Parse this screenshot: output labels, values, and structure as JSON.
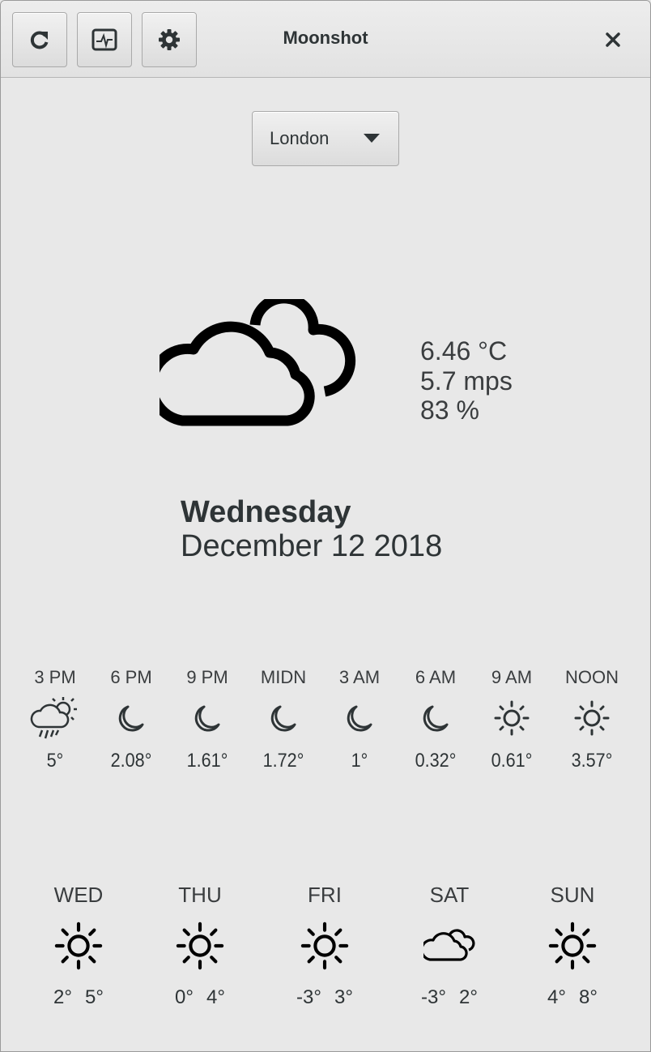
{
  "app": {
    "title": "Moonshot"
  },
  "header": {
    "buttons": [
      {
        "icon": "refresh-icon"
      },
      {
        "icon": "system-monitor-icon"
      },
      {
        "icon": "gear-icon"
      }
    ],
    "close_icon": "close-icon"
  },
  "location": {
    "selected": "London"
  },
  "current": {
    "icon": "cloudy-icon",
    "temperature": "6.46 °C",
    "wind": "5.7 mps",
    "humidity": "83 %",
    "day": "Wednesday",
    "date": "December 12 2018"
  },
  "hourly": [
    {
      "label": "3 PM",
      "icon": "rain-sun-icon",
      "temp": "5°"
    },
    {
      "label": "6 PM",
      "icon": "moon-icon",
      "temp": "2.08°"
    },
    {
      "label": "9 PM",
      "icon": "moon-icon",
      "temp": "1.61°"
    },
    {
      "label": "MIDN",
      "icon": "moon-icon",
      "temp": "1.72°"
    },
    {
      "label": "3 AM",
      "icon": "moon-icon",
      "temp": "1°"
    },
    {
      "label": "6 AM",
      "icon": "moon-icon",
      "temp": "0.32°"
    },
    {
      "label": "9 AM",
      "icon": "sun-icon",
      "temp": "0.61°"
    },
    {
      "label": "NOON",
      "icon": "sun-icon",
      "temp": "3.57°"
    }
  ],
  "daily": [
    {
      "label": "WED",
      "icon": "sun-icon",
      "low": "2°",
      "high": "5°"
    },
    {
      "label": "THU",
      "icon": "sun-icon",
      "low": "0°",
      "high": "4°"
    },
    {
      "label": "FRI",
      "icon": "sun-icon",
      "low": "-3°",
      "high": "3°"
    },
    {
      "label": "SAT",
      "icon": "cloud-icon",
      "low": "-3°",
      "high": "2°"
    },
    {
      "label": "SUN",
      "icon": "sun-icon",
      "low": "4°",
      "high": "8°"
    }
  ]
}
